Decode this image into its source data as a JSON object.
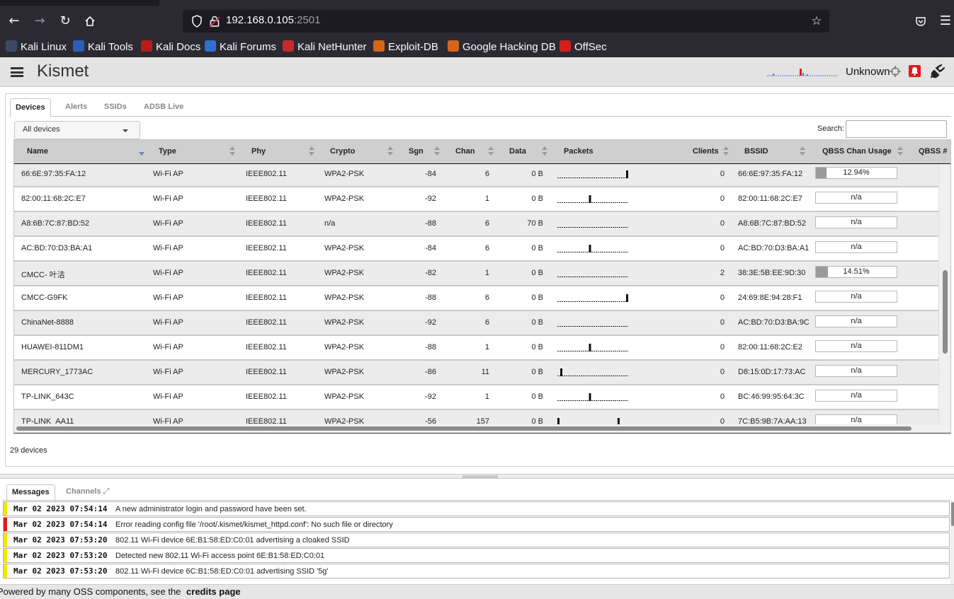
{
  "browser": {
    "url_host": "192.168.0.105",
    "url_port": ":2501",
    "bookmarks": [
      {
        "label": "Kali Linux",
        "icon": "kali-dragon-icon"
      },
      {
        "label": "Kali Tools",
        "icon": "kali-tools-icon"
      },
      {
        "label": "Kali Docs",
        "icon": "kali-docs-icon"
      },
      {
        "label": "Kali Forums",
        "icon": "kali-forums-icon"
      },
      {
        "label": "Kali NetHunter",
        "icon": "nethunter-icon"
      },
      {
        "label": "Exploit-DB",
        "icon": "exploit-db-icon"
      },
      {
        "label": "Google Hacking DB",
        "icon": "ghdb-icon"
      },
      {
        "label": "OffSec",
        "icon": "offsec-icon"
      }
    ]
  },
  "header": {
    "title": "Kismet",
    "gps_status": "Unknown"
  },
  "main": {
    "tabs": [
      "Devices",
      "Alerts",
      "SSIDs",
      "ADSB Live"
    ],
    "filter": "All devices",
    "search_label": "Search:",
    "columns": [
      "Name",
      "Type",
      "Phy",
      "Crypto",
      "Sgn",
      "Chan",
      "Data",
      "Packets",
      "Clients",
      "BSSID",
      "QBSS Chan Usage",
      "QBSS #"
    ],
    "rows": [
      {
        "name": "66:6E:97:35:FA:12",
        "type": "Wi-Fi AP",
        "phy": "IEEE802.11",
        "crypto": "WPA2-PSK",
        "sgn": "-84",
        "chan": "6",
        "data": "0 B",
        "packets": [
          0,
          0,
          0,
          0,
          0,
          0,
          0,
          0,
          0,
          0,
          0,
          0,
          0,
          0,
          0,
          0,
          0,
          0,
          0,
          0,
          0,
          0,
          0,
          0,
          0,
          0,
          0,
          0,
          0,
          0,
          0,
          0,
          0,
          0,
          0,
          0,
          0,
          0,
          0,
          0,
          0,
          0,
          0,
          0,
          0,
          0,
          0,
          0,
          1
        ],
        "clients": "0",
        "bssid": "66:6E:97:35:FA:12",
        "qbss": "12.94%",
        "qbss_pct": 12.94
      },
      {
        "name": "82:00:11:68:2C:E7",
        "type": "Wi-Fi AP",
        "phy": "IEEE802.11",
        "crypto": "WPA2-PSK",
        "sgn": "-92",
        "chan": "1",
        "data": "0 B",
        "packets": [
          0,
          0,
          0,
          0,
          0,
          0,
          0,
          0,
          0,
          0,
          0,
          0,
          0,
          0,
          0,
          0,
          0,
          0,
          0,
          0,
          0,
          0,
          1,
          0,
          0,
          0,
          0,
          0,
          0,
          0,
          0,
          0,
          0,
          0,
          0,
          0,
          0,
          0,
          0,
          0,
          0,
          0,
          0,
          0,
          0,
          0,
          0,
          0,
          0
        ],
        "clients": "0",
        "bssid": "82:00:11:68:2C:E7",
        "qbss": "n/a",
        "qbss_pct": 0
      },
      {
        "name": "A8:6B:7C:87:BD:52",
        "type": "Wi-Fi AP",
        "phy": "IEEE802.11",
        "crypto": "n/a",
        "sgn": "-88",
        "chan": "6",
        "data": "70 B",
        "packets": [
          0,
          0,
          0,
          0,
          0,
          0,
          0,
          0,
          0,
          0,
          0,
          0,
          0,
          0,
          0,
          0,
          0,
          0,
          0,
          0,
          0,
          0,
          0,
          0,
          0,
          0,
          0,
          0,
          0,
          0,
          0,
          0,
          0,
          0,
          0,
          0,
          0,
          0,
          0,
          0,
          0,
          0,
          0,
          0,
          0,
          0,
          0,
          0,
          0
        ],
        "clients": "0",
        "bssid": "A8:6B:7C:87:BD:52",
        "qbss": "n/a",
        "qbss_pct": 0
      },
      {
        "name": "AC:BD:70:D3:BA:A1",
        "type": "Wi-Fi AP",
        "phy": "IEEE802.11",
        "crypto": "WPA2-PSK",
        "sgn": "-84",
        "chan": "6",
        "data": "0 B",
        "packets": [
          0,
          0,
          0,
          0,
          0,
          0,
          0,
          0,
          0,
          0,
          0,
          0,
          0,
          0,
          0,
          0,
          0,
          0,
          0,
          0,
          0,
          0,
          1,
          0,
          0,
          0,
          0,
          0,
          0,
          0,
          0,
          0,
          0,
          0,
          0,
          0,
          0,
          0,
          0,
          0,
          0,
          0,
          0,
          0,
          0,
          0,
          0,
          0,
          0
        ],
        "clients": "0",
        "bssid": "AC:BD:70:D3:BA:A1",
        "qbss": "n/a",
        "qbss_pct": 0
      },
      {
        "name": "CMCC- 叶洁",
        "type": "Wi-Fi AP",
        "phy": "IEEE802.11",
        "crypto": "WPA2-PSK",
        "sgn": "-82",
        "chan": "1",
        "data": "0 B",
        "packets": [
          0,
          0,
          0,
          0,
          0,
          0,
          0,
          0,
          0,
          0,
          0,
          0,
          0,
          0,
          0,
          0,
          0,
          0,
          0,
          0,
          0,
          0,
          0,
          0,
          0,
          0,
          0,
          0,
          0,
          0,
          0,
          0,
          0,
          0,
          0,
          0,
          0,
          0,
          0,
          0,
          0,
          0,
          0,
          0,
          0,
          0,
          0,
          0,
          0
        ],
        "clients": "2",
        "bssid": "38:3E:5B:EE:9D:30",
        "qbss": "14.51%",
        "qbss_pct": 14.51
      },
      {
        "name": "CMCC-G9FK",
        "type": "Wi-Fi AP",
        "phy": "IEEE802.11",
        "crypto": "WPA2-PSK",
        "sgn": "-88",
        "chan": "6",
        "data": "0 B",
        "packets": [
          0,
          0,
          0,
          0,
          0,
          0,
          0,
          0,
          0,
          0,
          0,
          0,
          0,
          0,
          0,
          0,
          0,
          0,
          0,
          0,
          0,
          0,
          0,
          0,
          0,
          0,
          0,
          0,
          0,
          0,
          0,
          0,
          0,
          0,
          0,
          0,
          0,
          0,
          0,
          0,
          0,
          0,
          0,
          0,
          0,
          0,
          0,
          0,
          1
        ],
        "clients": "0",
        "bssid": "24:69:8E:94:28:F1",
        "qbss": "n/a",
        "qbss_pct": 0
      },
      {
        "name": "ChinaNet-8888",
        "type": "Wi-Fi AP",
        "phy": "IEEE802.11",
        "crypto": "WPA2-PSK",
        "sgn": "-92",
        "chan": "6",
        "data": "0 B",
        "packets": [
          0,
          0,
          0,
          0,
          0,
          0,
          0,
          0,
          0,
          0,
          0,
          0,
          0,
          0,
          0,
          0,
          0,
          0,
          0,
          0,
          0,
          0,
          0,
          0,
          0,
          0,
          0,
          0,
          0,
          0,
          0,
          0,
          0,
          0,
          0,
          0,
          0,
          0,
          0,
          0,
          0,
          0,
          0,
          0,
          0,
          0,
          0,
          0,
          0
        ],
        "clients": "0",
        "bssid": "AC:BD:70:D3:BA:9C",
        "qbss": "n/a",
        "qbss_pct": 0
      },
      {
        "name": "HUAWEI-811DM1",
        "type": "Wi-Fi AP",
        "phy": "IEEE802.11",
        "crypto": "WPA2-PSK",
        "sgn": "-88",
        "chan": "1",
        "data": "0 B",
        "packets": [
          0,
          0,
          0,
          0,
          0,
          0,
          0,
          0,
          0,
          0,
          0,
          0,
          0,
          0,
          0,
          0,
          0,
          0,
          0,
          0,
          0,
          0,
          1,
          0,
          0,
          0,
          0,
          0,
          0,
          0,
          0,
          0,
          0,
          0,
          0,
          0,
          0,
          0,
          0,
          0,
          0,
          0,
          0,
          0,
          0,
          0,
          0,
          0,
          0
        ],
        "clients": "0",
        "bssid": "82:00:11:68:2C:E2",
        "qbss": "n/a",
        "qbss_pct": 0
      },
      {
        "name": "MERCURY_1773AC",
        "type": "Wi-Fi AP",
        "phy": "IEEE802.11",
        "crypto": "WPA2-PSK",
        "sgn": "-86",
        "chan": "11",
        "data": "0 B",
        "packets": [
          0,
          0,
          1,
          0,
          0,
          0,
          0,
          0,
          0,
          0,
          0,
          0,
          0,
          0,
          0,
          0,
          0,
          0,
          0,
          0,
          0,
          0,
          0,
          0,
          0,
          0,
          0,
          0,
          0,
          0,
          0,
          0,
          0,
          0,
          0,
          0,
          0,
          0,
          0,
          0,
          0,
          0,
          0,
          0,
          0,
          0,
          0,
          0,
          0
        ],
        "clients": "0",
        "bssid": "D8:15:0D:17:73:AC",
        "qbss": "n/a",
        "qbss_pct": 0
      },
      {
        "name": "TP-LINK_643C",
        "type": "Wi-Fi AP",
        "phy": "IEEE802.11",
        "crypto": "WPA2-PSK",
        "sgn": "-92",
        "chan": "1",
        "data": "0 B",
        "packets": [
          0,
          0,
          0,
          0,
          0,
          0,
          0,
          0,
          0,
          0,
          0,
          0,
          0,
          0,
          0,
          0,
          0,
          0,
          0,
          0,
          0,
          0,
          1,
          0,
          0,
          0,
          0,
          0,
          0,
          0,
          0,
          0,
          0,
          0,
          0,
          0,
          0,
          0,
          0,
          0,
          0,
          0,
          0,
          0,
          0,
          0,
          0,
          0,
          0
        ],
        "clients": "0",
        "bssid": "BC:46:99:95:64:3C",
        "qbss": "n/a",
        "qbss_pct": 0
      },
      {
        "name": "TP-LINK_AA11",
        "type": "Wi-Fi AP",
        "phy": "IEEE802.11",
        "crypto": "WPA2-PSK",
        "sgn": "-56",
        "chan": "157",
        "data": "0 B",
        "packets": [
          1,
          0,
          0,
          0,
          0,
          0,
          0,
          0,
          0,
          0,
          0,
          0,
          0,
          0,
          0,
          0,
          0,
          0,
          0,
          0,
          0,
          0,
          0,
          0,
          0,
          0,
          0,
          0,
          0,
          0,
          0,
          0,
          0,
          0,
          0,
          0,
          0,
          0,
          0,
          0,
          0,
          0,
          1,
          0,
          0,
          0,
          0,
          0,
          0
        ],
        "clients": "0",
        "bssid": "7C:B5:9B:7A:AA:13",
        "qbss": "n/a",
        "qbss_pct": 0
      }
    ],
    "device_count": "29 devices"
  },
  "messages": {
    "tabs": [
      "Messages",
      "Channels"
    ],
    "items": [
      {
        "ts": "Mar 02 2023 07:54:14",
        "text": "A new administrator login and password have been set.",
        "level": "info"
      },
      {
        "ts": "Mar 02 2023 07:54:14",
        "text": "Error reading config file '/root/.kismet/kismet_httpd.conf': No such file or directory",
        "level": "error"
      },
      {
        "ts": "Mar 02 2023 07:53:20",
        "text": "802.11 Wi-Fi device 6E:B1:58:ED:C0:01 advertising a cloaked SSID",
        "level": "info"
      },
      {
        "ts": "Mar 02 2023 07:53:20",
        "text": "Detected new 802.11 Wi-Fi access point 6E:B1:58:ED:C0:01",
        "level": "info"
      },
      {
        "ts": "Mar 02 2023 07:53:20",
        "text": "802.11 Wi-Fi device 6C:B1:58:ED:C0:01 advertising SSID '5g'",
        "level": "info"
      }
    ]
  },
  "footer": {
    "prefix": "Powered by many OSS components, see the ",
    "link": "credits page"
  },
  "colors": {
    "browser_bg": "#2b2a33",
    "header_bg": "#e3e3e3",
    "msg_info": "#f5e600",
    "msg_error": "#e01b1b",
    "alert": "#e21b1b"
  }
}
